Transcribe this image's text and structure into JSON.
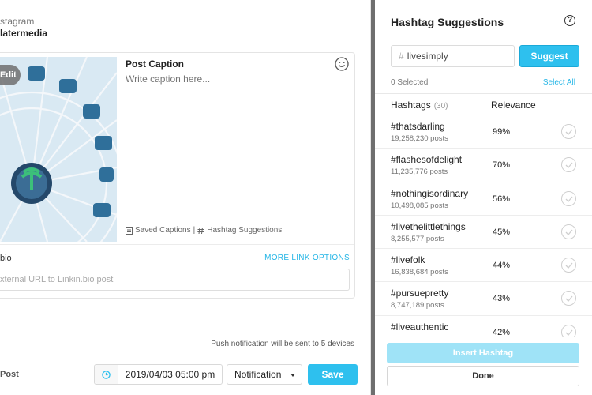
{
  "account": {
    "type_label": "stagram",
    "name": "latermedia"
  },
  "post_card": {
    "edit_label": "Edit",
    "caption_title": "Post Caption",
    "caption_placeholder": "Write caption here...",
    "saved_captions_label": "Saved Captions",
    "links_separator": "|",
    "hashtag_suggestions_label": "Hashtag Suggestions",
    "link_label": "bio",
    "more_link_options": "MORE LINK OPTIONS",
    "url_placeholder": "xternal URL to Linkin.bio post"
  },
  "push_note": "Push notification will be sent to 5 devices",
  "footer": {
    "post_label": "Post",
    "date_value": "2019/04/03 05:00 pm",
    "notification_value": "Notification",
    "save_label": "Save"
  },
  "panel": {
    "title": "Hashtag Suggestions",
    "help_label": "?",
    "search_hash": "#",
    "search_value": "livesimply",
    "suggest_label": "Suggest",
    "selected_count": "0 Selected",
    "select_all": "Select All",
    "col_hashtags": "Hashtags",
    "col_count": "(30)",
    "col_relevance": "Relevance",
    "rows": [
      {
        "tag": "#thatsdarling",
        "posts": "19,258,230 posts",
        "relevance": "99%"
      },
      {
        "tag": "#flashesofdelight",
        "posts": "11,235,776 posts",
        "relevance": "70%"
      },
      {
        "tag": "#nothingisordinary",
        "posts": "10,498,085 posts",
        "relevance": "56%"
      },
      {
        "tag": "#livethelittlethings",
        "posts": "8,255,577 posts",
        "relevance": "45%"
      },
      {
        "tag": "#livefolk",
        "posts": "16,838,684 posts",
        "relevance": "44%"
      },
      {
        "tag": "#pursuepretty",
        "posts": "8,747,189 posts",
        "relevance": "43%"
      },
      {
        "tag": "#liveauthentic",
        "posts": "",
        "relevance": "42%"
      }
    ],
    "insert_label": "Insert Hashtag",
    "done_label": "Done"
  },
  "colors": {
    "accent": "#2ec0ee",
    "link": "#26b6e6",
    "insert_disabled": "#9fe3f7"
  }
}
